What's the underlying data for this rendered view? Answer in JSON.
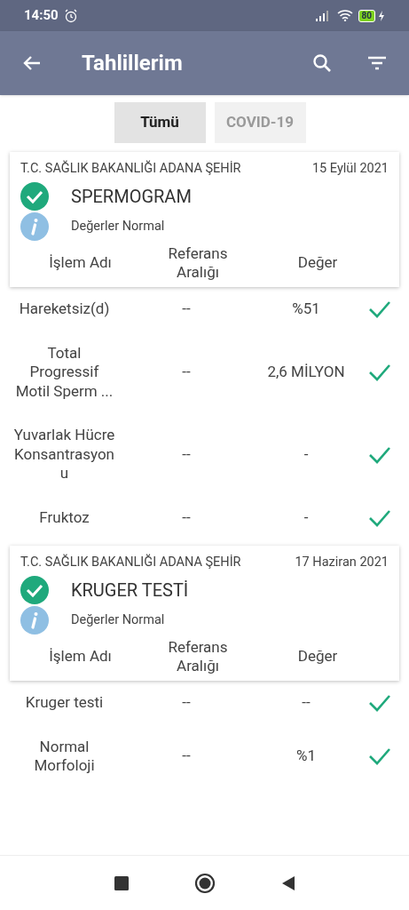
{
  "status_bar": {
    "time": "14:50",
    "battery": "80"
  },
  "app_bar": {
    "title": "Tahlillerim"
  },
  "tabs": [
    {
      "label": "Tümü",
      "selected": true
    },
    {
      "label": "COVID-19",
      "selected": false
    }
  ],
  "results": [
    {
      "hospital": "T.C. SAĞLIK BAKANLIĞI ADANA ŞEHİR",
      "date": "15 Eylül 2021",
      "test": "SPERMOGRAM",
      "summary": "Değerler Normal",
      "normal": true,
      "columns": [
        "İşlem Adı",
        "Referans Aralığı",
        "Değer"
      ],
      "rows": [
        {
          "name": "Hareketsiz(d)",
          "reference": "--",
          "value": "%51",
          "normal": true
        },
        {
          "name": "Total Progressif Motil Sperm ...",
          "reference": "--",
          "value": "2,6  MİLYON",
          "normal": true
        },
        {
          "name": "Yuvarlak Hücre Konsantrasyonu",
          "reference": "--",
          "value": "-",
          "normal": true
        },
        {
          "name": "Fruktoz",
          "reference": "--",
          "value": "-",
          "normal": true
        }
      ]
    },
    {
      "hospital": "T.C. SAĞLIK BAKANLIĞI ADANA ŞEHİR",
      "date": "17 Haziran 2021",
      "test": "KRUGER TESTİ",
      "summary": "Değerler Normal",
      "normal": true,
      "columns": [
        "İşlem Adı",
        "Referans Aralığı",
        "Değer"
      ],
      "rows": [
        {
          "name": "Kruger testi",
          "reference": "--",
          "value": "--",
          "normal": true
        },
        {
          "name": "Normal Morfoloji",
          "reference": "--",
          "value": "%1",
          "normal": true
        }
      ]
    }
  ]
}
